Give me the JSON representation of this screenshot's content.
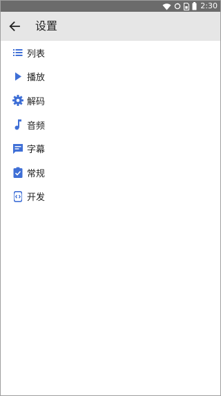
{
  "status_bar": {
    "time": "2:30",
    "icons": [
      "wifi-icon",
      "sync-icon",
      "sim-icon",
      "battery-icon"
    ]
  },
  "appbar": {
    "back_icon": "arrow-back-icon",
    "title": "设置"
  },
  "accent_color": "#3f6fd6",
  "menu": {
    "items": [
      {
        "label": "列表",
        "icon": "list-icon"
      },
      {
        "label": "播放",
        "icon": "play-icon"
      },
      {
        "label": "解码",
        "icon": "gear-icon"
      },
      {
        "label": "音频",
        "icon": "music-note-icon"
      },
      {
        "label": "字幕",
        "icon": "subtitle-icon"
      },
      {
        "label": "常规",
        "icon": "clipboard-check-icon"
      },
      {
        "label": "开发",
        "icon": "developer-icon"
      }
    ]
  }
}
